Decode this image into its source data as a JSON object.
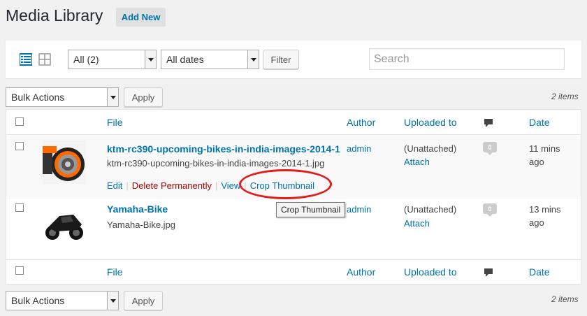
{
  "header": {
    "title": "Media Library",
    "add_new": "Add New"
  },
  "filters": {
    "type_select": "All (2)",
    "date_select": "All dates",
    "filter_button": "Filter",
    "search_placeholder": "Search"
  },
  "bulk_top": {
    "select": "Bulk Actions",
    "apply": "Apply",
    "count": "2 items"
  },
  "bulk_bottom": {
    "select": "Bulk Actions",
    "apply": "Apply",
    "count": "2 items"
  },
  "columns": {
    "file": "File",
    "author": "Author",
    "uploaded_to": "Uploaded to",
    "date": "Date"
  },
  "rows": [
    {
      "title": "ktm-rc390-upcoming-bikes-in-india-images-2014-1",
      "filename": "ktm-rc390-upcoming-bikes-in-india-images-2014-1.jpg",
      "author": "admin",
      "uploaded_to": "(Unattached)",
      "attach": "Attach",
      "comments": "0",
      "date_line1": "11 mins",
      "date_line2": "ago",
      "actions": {
        "edit": "Edit",
        "delete": "Delete Permanently",
        "view": "View",
        "crop": "Crop Thumbnail"
      }
    },
    {
      "title": "Yamaha-Bike",
      "filename": "Yamaha-Bike.jpg",
      "author": "admin",
      "uploaded_to": "(Unattached)",
      "attach": "Attach",
      "comments": "0",
      "date_line1": "13 mins",
      "date_line2": "ago"
    }
  ],
  "tooltip": "Crop Thumbnail",
  "icons": {
    "list_view": "list-view-icon",
    "grid_view": "grid-view-icon",
    "comments": "comment-bubble-icon"
  },
  "colors": {
    "link": "#0073aa",
    "delete": "#aa0000",
    "highlight": "#e31c1c"
  }
}
